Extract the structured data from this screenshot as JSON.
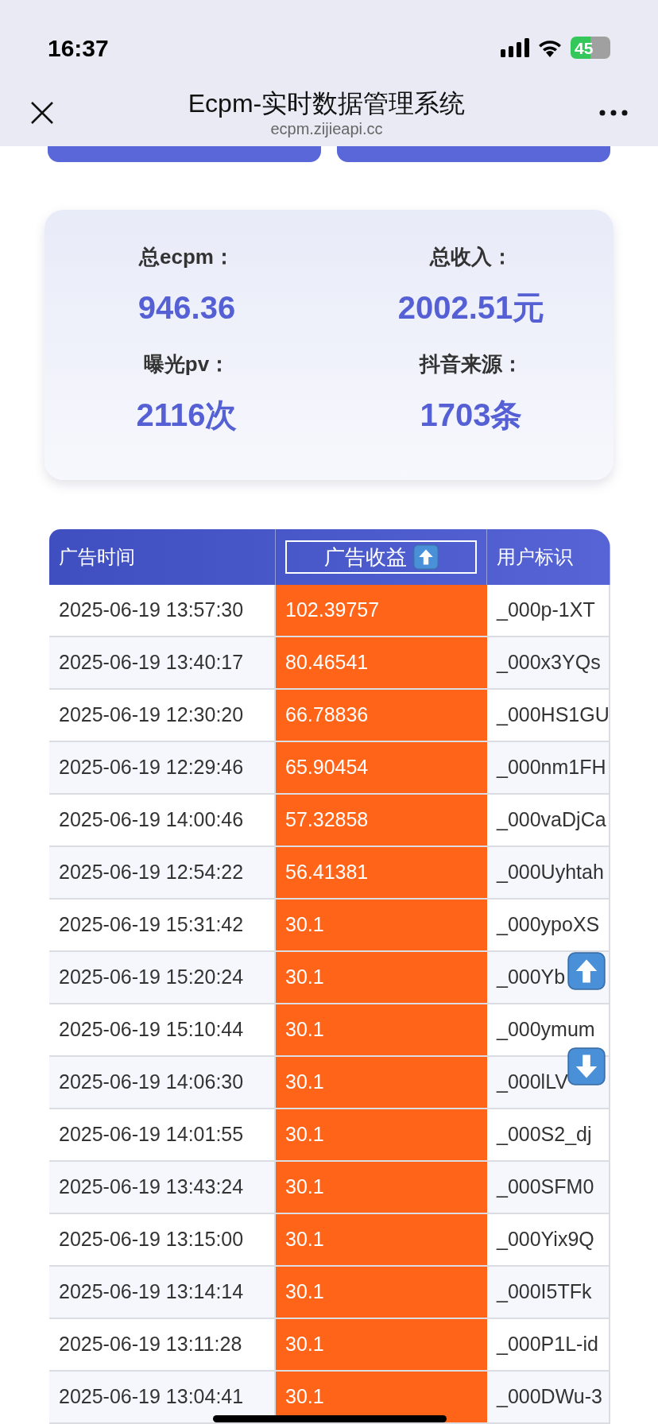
{
  "status_bar": {
    "time": "16:37",
    "battery": "45"
  },
  "browser_bar": {
    "title": "Ecpm-实时数据管理系统",
    "url": "ecpm.zijieapi.cc"
  },
  "stats": [
    {
      "label": "总ecpm：",
      "value": "946.36"
    },
    {
      "label": "总收入：",
      "value": "2002.51元"
    },
    {
      "label": "曝光pv：",
      "value": "2116次"
    },
    {
      "label": "抖音来源：",
      "value": "1703条"
    }
  ],
  "table": {
    "columns": [
      {
        "label": "广告时间",
        "sorted": false
      },
      {
        "label": "广告收益",
        "sorted": true
      },
      {
        "label": "用户标识",
        "sorted": false
      }
    ],
    "rows": [
      [
        "2025-06-19 13:57:30",
        "102.39757",
        "_000p-1XT"
      ],
      [
        "2025-06-19 13:40:17",
        "80.46541",
        "_000x3YQs"
      ],
      [
        "2025-06-19 12:30:20",
        "66.78836",
        "_000HS1GU"
      ],
      [
        "2025-06-19 12:29:46",
        "65.90454",
        "_000nm1FH"
      ],
      [
        "2025-06-19 14:00:46",
        "57.32858",
        "_000vaDjCa"
      ],
      [
        "2025-06-19 12:54:22",
        "56.41381",
        "_000Uyhtah"
      ],
      [
        "2025-06-19 15:31:42",
        "30.1",
        "_000ypoXS"
      ],
      [
        "2025-06-19 15:20:24",
        "30.1",
        "_000Yb"
      ],
      [
        "2025-06-19 15:10:44",
        "30.1",
        "_000ymum"
      ],
      [
        "2025-06-19 14:06:30",
        "30.1",
        "_000lLV"
      ],
      [
        "2025-06-19 14:01:55",
        "30.1",
        "_000S2_dj"
      ],
      [
        "2025-06-19 13:43:24",
        "30.1",
        "_000SFM0"
      ],
      [
        "2025-06-19 13:15:00",
        "30.1",
        "_000Yix9Q"
      ],
      [
        "2025-06-19 13:14:14",
        "30.1",
        "_000I5TFk"
      ],
      [
        "2025-06-19 13:11:28",
        "30.1",
        "_000P1L-id"
      ],
      [
        "2025-06-19 13:04:41",
        "30.1",
        "_000DWu-3"
      ]
    ]
  }
}
